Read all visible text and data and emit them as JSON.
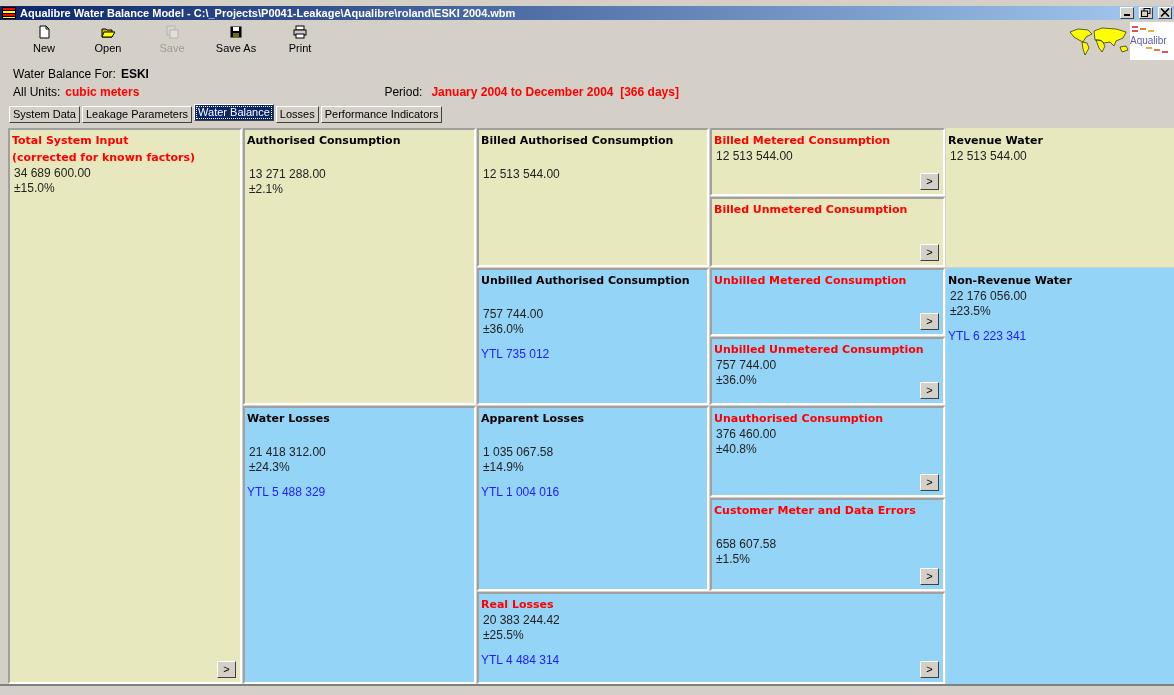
{
  "window": {
    "title": "Aqualibre Water Balance Model - C:\\_Projects\\P0041-Leakage\\Aqualibre\\roland\\ESKI 2004.wbm"
  },
  "toolbar": [
    {
      "label": "New",
      "kind": "new",
      "disabled": false
    },
    {
      "label": "Open",
      "kind": "open",
      "disabled": false
    },
    {
      "label": "Save",
      "kind": "save",
      "disabled": true
    },
    {
      "label": "Save As",
      "kind": "saveas",
      "disabled": false
    },
    {
      "label": "Print",
      "kind": "print",
      "disabled": false
    }
  ],
  "logo": {
    "text": "Aqualibr"
  },
  "header": {
    "balance_label": "Water Balance For:",
    "balance_name": "ESKI",
    "units_label": "All Units:",
    "units": "cubic meters",
    "period_label": "Period:",
    "period": "January 2004 to December 2004  [366 days]"
  },
  "tabs": [
    {
      "label": "System Data",
      "selected": false
    },
    {
      "label": "Leakage Parameters",
      "selected": false
    },
    {
      "label": "Water Balance",
      "selected": true
    },
    {
      "label": "Losses",
      "selected": false
    },
    {
      "label": "Performance Indicators",
      "selected": false
    }
  ],
  "cells": [
    {
      "title": "Total System Input",
      "subtitle": "(corrected for known factors)",
      "highlight": true,
      "color": "#e8e8bf",
      "value": "34 689 600.00",
      "uncertainty": "±15.0%",
      "button": ">"
    },
    {
      "title": "Authorised Consumption",
      "highlight": false,
      "color": "#e8e8bf",
      "value": "13 271 288.00",
      "uncertainty": "±2.1%"
    },
    {
      "title": "Billed Authorised Consumption",
      "highlight": false,
      "color": "#e8e8bf",
      "value": "12 513 544.00"
    },
    {
      "title": "Billed Metered Consumption",
      "highlight": true,
      "color": "#e8e8bf",
      "value": "12 513 544.00",
      "button": ">"
    },
    {
      "title": "Revenue Water",
      "highlight": false,
      "color": "#e8e8bf",
      "value": "12 513 544.00"
    },
    {
      "title": "Billed Unmetered Consumption",
      "highlight": true,
      "color": "#e8e8bf",
      "button": ">"
    },
    {
      "title": "Unbilled Authorised Consumption",
      "highlight": false,
      "color": "#94d4f6",
      "value": "757 744.00",
      "uncertainty": "±36.0%",
      "cost": "YTL 735 012"
    },
    {
      "title": "Unbilled Metered Consumption",
      "highlight": true,
      "color": "#94d4f6",
      "button": ">"
    },
    {
      "title": "Non-Revenue Water",
      "highlight": false,
      "color": "#94d4f6",
      "value": "22 176 056.00",
      "uncertainty": "±23.5%",
      "cost": "YTL 6 223 341"
    },
    {
      "title": "Unbilled Unmetered Consumption",
      "highlight": true,
      "color": "#94d4f6",
      "value": "757 744.00",
      "uncertainty": "±36.0%",
      "button": ">"
    },
    {
      "title": "Water Losses",
      "highlight": false,
      "color": "#94d4f6",
      "value": "21 418 312.00",
      "uncertainty": "±24.3%",
      "cost": "YTL 5 488 329"
    },
    {
      "title": "Apparent Losses",
      "highlight": false,
      "color": "#94d4f6",
      "value": "1 035 067.58",
      "uncertainty": "±14.9%",
      "cost": "YTL 1 004 016"
    },
    {
      "title": "Unauthorised Consumption",
      "highlight": true,
      "color": "#94d4f6",
      "value": "376 460.00",
      "uncertainty": "±40.8%",
      "button": ">"
    },
    {
      "title": "Customer Meter and Data Errors",
      "highlight": true,
      "color": "#94d4f6",
      "value": "658 607.58",
      "uncertainty": "±1.5%",
      "button": ">"
    },
    {
      "title": "Real Losses",
      "highlight": true,
      "color": "#94d4f6",
      "value": "20 383 244.42",
      "uncertainty": "±25.5%",
      "cost": "YTL 4 484 314",
      "button": ">"
    }
  ]
}
